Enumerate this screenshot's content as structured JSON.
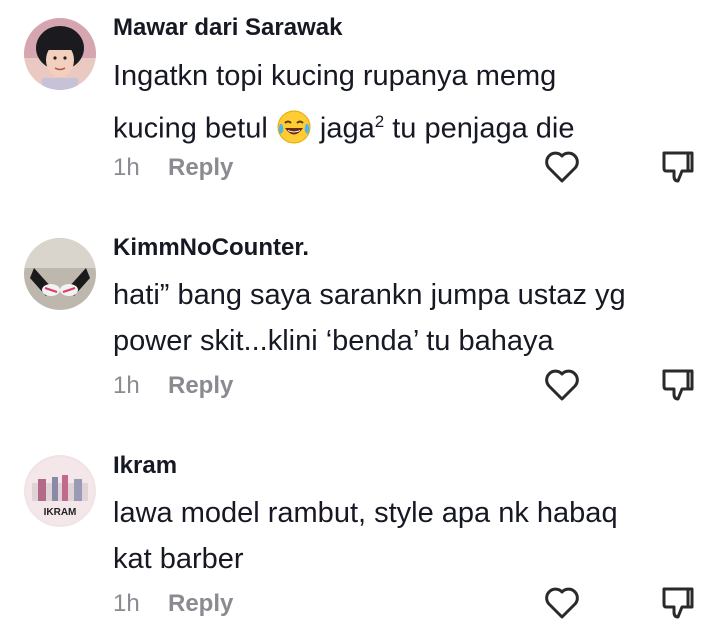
{
  "comments": [
    {
      "username": "Mawar dari Sarawak",
      "line1": "Ingatkn topi kucing rupanya memg",
      "line2_before": "kucing betul ",
      "emoji": "face-with-tears-of-joy-emoji",
      "line2_mid": " jaga",
      "line2_sup": "2",
      "line2_after": " tu penjaga die",
      "time": "1h",
      "reply": "Reply"
    },
    {
      "username": "KimmNoCounter.",
      "line1": "hati” bang saya sarankn jumpa ustaz yg",
      "line2": "power skit...klini ‘benda’ tu bahaya",
      "time": "1h",
      "reply": "Reply"
    },
    {
      "username": "Ikram",
      "avatar_text": "IKRAM",
      "line1": "lawa model rambut, style apa nk habaq",
      "line2": "kat barber",
      "time": "1h",
      "reply": "Reply"
    }
  ],
  "icons": {
    "like": "heart-outline-icon",
    "dislike": "thumbs-down-icon"
  }
}
